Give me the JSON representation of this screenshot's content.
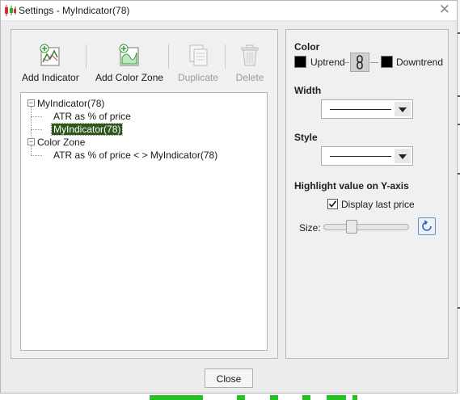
{
  "window": {
    "title": "Settings - MyIndicator(78)",
    "close_glyph": "✕"
  },
  "toolbar": {
    "add_indicator": "Add Indicator",
    "add_color_zone": "Add Color Zone",
    "duplicate": "Duplicate",
    "delete": "Delete"
  },
  "tree": {
    "root1": "MyIndicator(78)",
    "child_atr": "ATR as % of price",
    "child_selected": "MyIndicator(78)",
    "root2": "Color Zone",
    "color_zone_item": "ATR as % of price < > MyIndicator(78)"
  },
  "settings": {
    "color_label": "Color",
    "uptrend_label": "Uptrend",
    "downtrend_label": "Downtrend",
    "uptrend_color": "#000000",
    "downtrend_color": "#000000",
    "width_label": "Width",
    "style_label": "Style",
    "highlight_label": "Highlight value on Y-axis",
    "display_last_price_label": "Display last price",
    "display_last_price_checked": true,
    "size_label": "Size:",
    "size_value": 0.3
  },
  "footer": {
    "close_label": "Close"
  }
}
